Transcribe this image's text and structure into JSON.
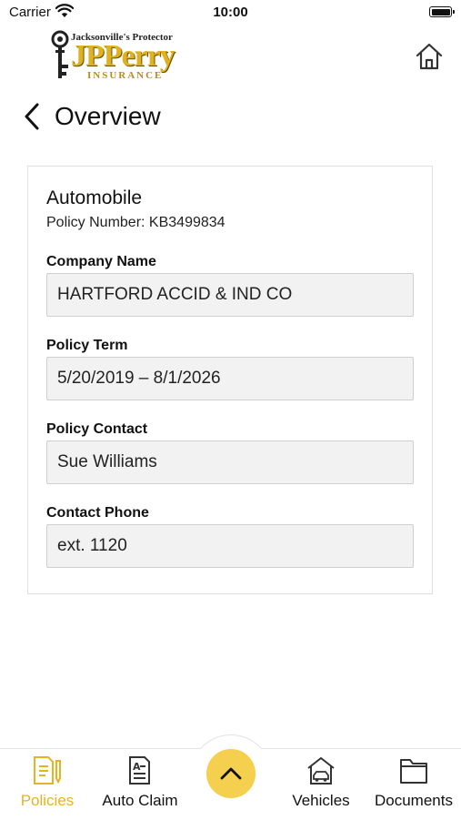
{
  "status_bar": {
    "carrier": "Carrier",
    "time": "10:00"
  },
  "header": {
    "logo_tagline": "Jacksonville's Protector",
    "logo_brand": "JPPerry",
    "logo_sub": "INSURANCE",
    "home_icon": "home-icon"
  },
  "page": {
    "title": "Overview",
    "back_icon": "chevron-left-icon"
  },
  "policy": {
    "type": "Automobile",
    "number_text": "Policy Number: KB3499834",
    "fields": [
      {
        "label": "Company Name",
        "value": "HARTFORD ACCID & IND CO"
      },
      {
        "label": "Policy Term",
        "value": "5/20/2019 – 8/1/2026"
      },
      {
        "label": "Policy Contact",
        "value": "Sue Williams"
      },
      {
        "label": "Contact Phone",
        "value": "ext. 1120"
      }
    ]
  },
  "tabbar": {
    "tabs": [
      {
        "label": "Policies",
        "icon": "policies-icon",
        "active": true
      },
      {
        "label": "Auto Claim",
        "icon": "auto-claim-icon",
        "active": false
      },
      {
        "label": "Vehicles",
        "icon": "vehicles-icon",
        "active": false
      },
      {
        "label": "Documents",
        "icon": "documents-icon",
        "active": false
      }
    ],
    "center_button_icon": "chevron-up-icon"
  },
  "colors": {
    "accent": "#E6B422",
    "fab": "#F5CF4E",
    "field_bg": "#F2F2F2"
  }
}
